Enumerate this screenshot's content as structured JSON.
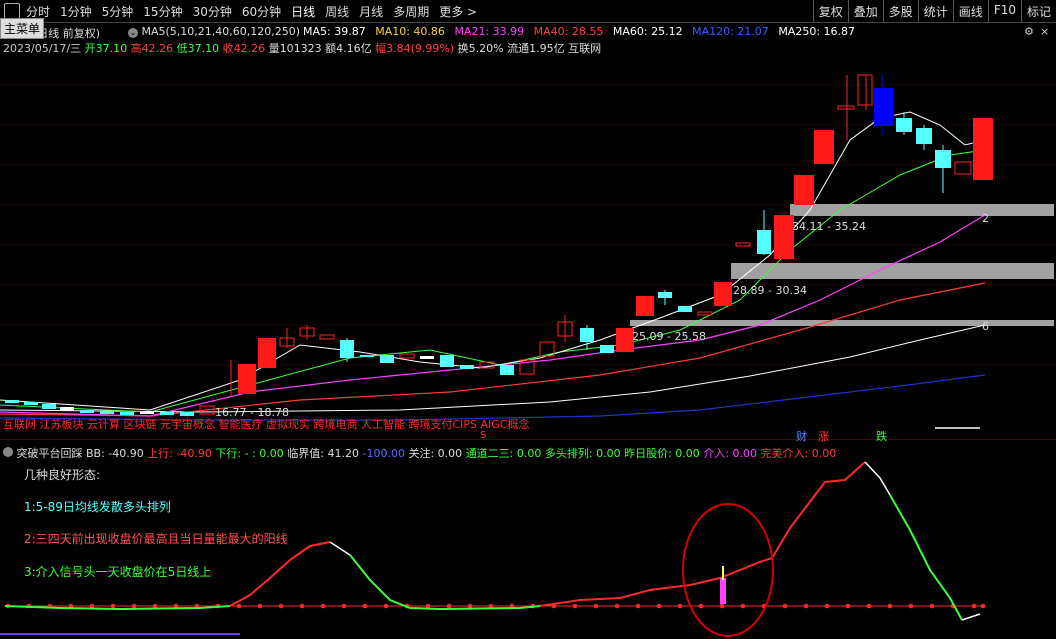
{
  "topbar": {
    "tabs": [
      "分时",
      "1分钟",
      "5分钟",
      "15分钟",
      "30分钟",
      "60分钟",
      "日线",
      "周线",
      "月线",
      "多周期",
      "更多"
    ],
    "more_arrow": ">",
    "right_buttons": [
      "复权",
      "叠加",
      "多股",
      "统计",
      "画线",
      "F10",
      "标记"
    ]
  },
  "menu_label": "主菜单",
  "main_chart": {
    "title": "技(日线 前复权)",
    "ma_params": "MA5(5,10,21,40,60,120,250)",
    "ma_values": [
      {
        "label": "MA5: 39.87",
        "color": "#ffffff"
      },
      {
        "label": "MA10: 40.86",
        "color": "#f5d23c"
      },
      {
        "label": "MA21: 33.99",
        "color": "#ff40ff"
      },
      {
        "label": "MA40: 28.55",
        "color": "#ff4040"
      },
      {
        "label": "MA60: 25.12",
        "color": "#ffffff"
      },
      {
        "label": "MA120: 21.07",
        "color": "#3a5bff"
      },
      {
        "label": "MA250: 16.87",
        "color": "#ffffff"
      }
    ],
    "quote": {
      "date": "2023/05/17/三",
      "open": "开37.10",
      "high": "高42.26",
      "low": "低37.10",
      "close": "收42.26",
      "volume": "量101323",
      "amount": "额4.16亿",
      "change": "幅3.84(9.99%)",
      "turnover": "换5.20%",
      "float": "流通1.95亿",
      "sector": "互联网"
    },
    "concepts": "互联网 江苏板块 云计算 区块链 元宇宙概念 智能医疗 虚拟现实 跨境电商 人工智能 跨境支付CIPS AIGC概念",
    "zone_labels": [
      "34.11 - 35.24",
      "28.89 - 30.34",
      "25.09 - 25.58",
      "16.77 - 18.78"
    ],
    "zone_numbers": [
      "2",
      "6"
    ],
    "markers": {
      "cai": "财",
      "zhang": "涨",
      "die": "跌",
      "s": "S"
    }
  },
  "indicator": {
    "name": "突破平台回踩",
    "bb": "BB: -40.90",
    "up": "上行: -40.90",
    "down": "下行: - : 0.00",
    "critical": "临界值: 41.20",
    "neg100": "-100.00",
    "focus": "关注: 0.00",
    "channel": "通道二三: 0.00",
    "bull": "多头排列: 0.00",
    "yesterday": "昨日股价: 0.00",
    "entry": "介入: 0.00",
    "perfect": "完美介入: 0.00",
    "notes": [
      "几种良好形态:",
      "1:5-89日均线发散多头排列",
      "2:三四天前出现收盘价最高且当日量能最大的阳线",
      "3:介入信号头一天收盘价在5日线上"
    ]
  },
  "colors": {
    "up": "#ff1a1a",
    "down": "#54ffff",
    "yang_fill": "#ff1a1a",
    "bg": "#000000",
    "accent_blue": "#0000ff"
  }
}
